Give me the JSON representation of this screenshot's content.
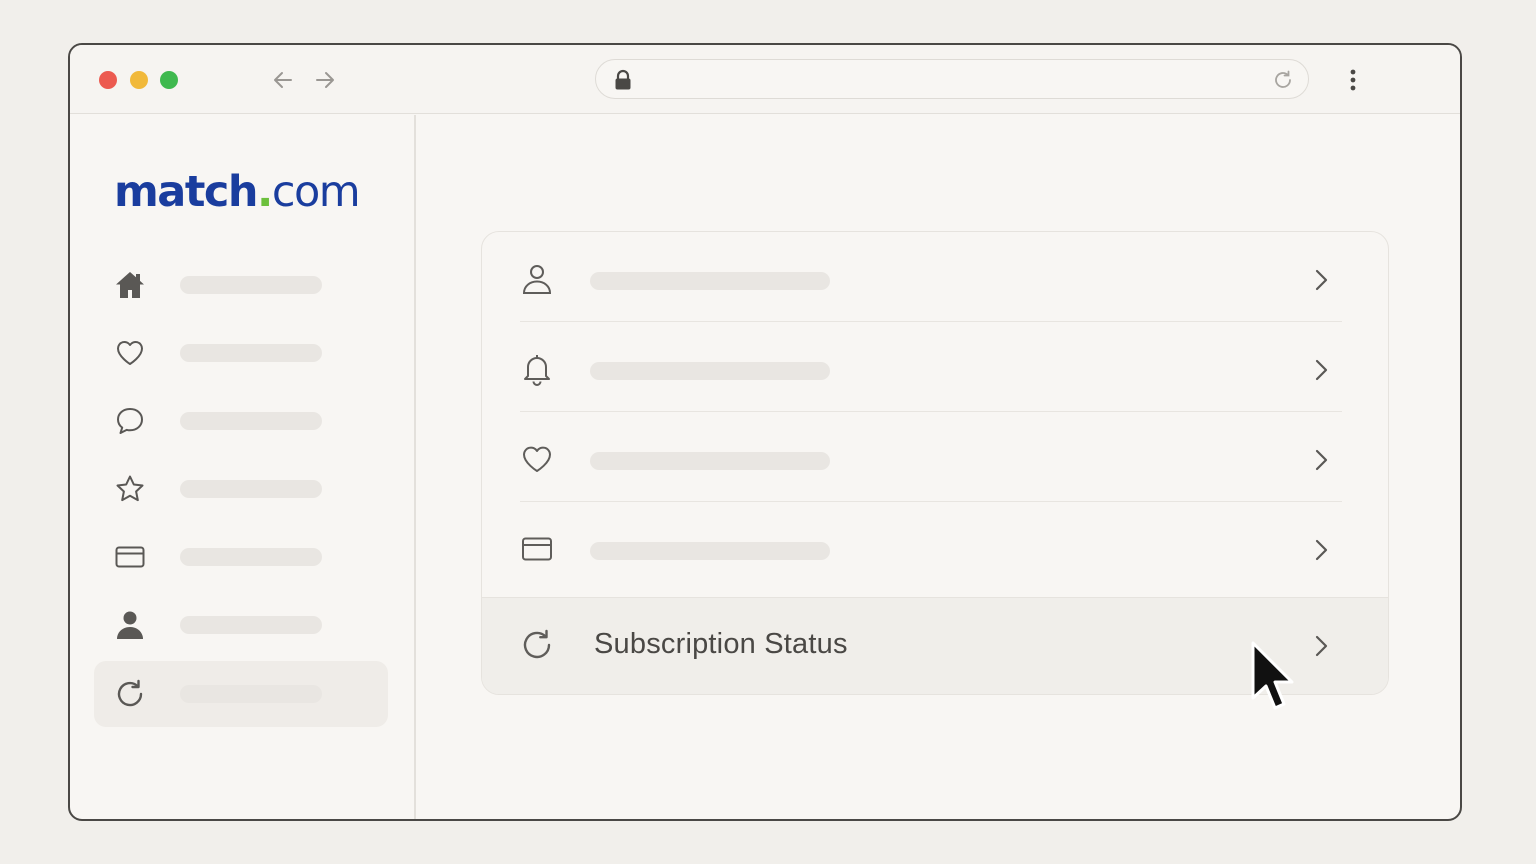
{
  "window": {
    "traffic_lights": [
      "close",
      "minimize",
      "maximize"
    ],
    "colors": {
      "close": "#ec5a50",
      "minimize": "#f1b93b",
      "maximize": "#3fb94f"
    }
  },
  "toolbar": {
    "back_icon": "arrow-left-icon",
    "forward_icon": "arrow-right-icon",
    "address_icon": "lock-icon",
    "reload_icon": "reload-icon",
    "menu_icon": "kebab-menu-icon"
  },
  "brand": {
    "logo_bold": "match",
    "logo_dot": ".",
    "logo_rest": "com",
    "colors": {
      "primary": "#1a3d9e",
      "dot": "#6cc03c"
    }
  },
  "sidebar": {
    "items": [
      {
        "icon": "home-icon"
      },
      {
        "icon": "heart-icon"
      },
      {
        "icon": "chat-bubble-icon"
      },
      {
        "icon": "star-icon"
      },
      {
        "icon": "credit-card-icon"
      },
      {
        "icon": "person-icon"
      },
      {
        "icon": "refresh-icon",
        "active": true
      }
    ]
  },
  "settings_list": {
    "rows": [
      {
        "icon": "person-icon"
      },
      {
        "icon": "bell-icon"
      },
      {
        "icon": "heart-icon"
      },
      {
        "icon": "credit-card-icon"
      },
      {
        "icon": "refresh-icon",
        "label": "Subscription Status",
        "highlighted": true
      }
    ]
  }
}
